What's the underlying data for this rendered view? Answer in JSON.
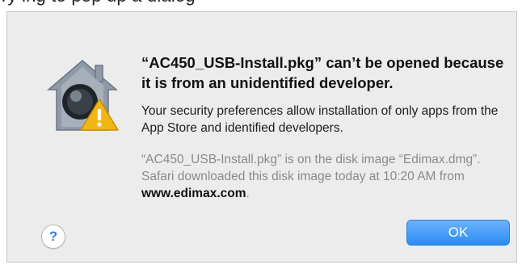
{
  "background_text": "ry ing to pop up a dialog",
  "dialog": {
    "icon": "gatekeeper-warning-icon",
    "title": "“AC450_USB-Install.pkg” can’t be opened because it is from an unidentified developer.",
    "message": "Your security preferences allow installation of only apps from the App Store and identified developers.",
    "detail_prefix": "“AC450_USB-Install.pkg” is on the disk image “Edimax.dmg”. Safari downloaded this disk image today at 10:20 AM from ",
    "detail_site": "www.edimax.com",
    "detail_suffix": ".",
    "help_label": "?",
    "ok_label": "OK"
  },
  "colors": {
    "accent": "#2a8cf4",
    "warning": "#f2b613",
    "dialog_bg": "#ececec"
  }
}
